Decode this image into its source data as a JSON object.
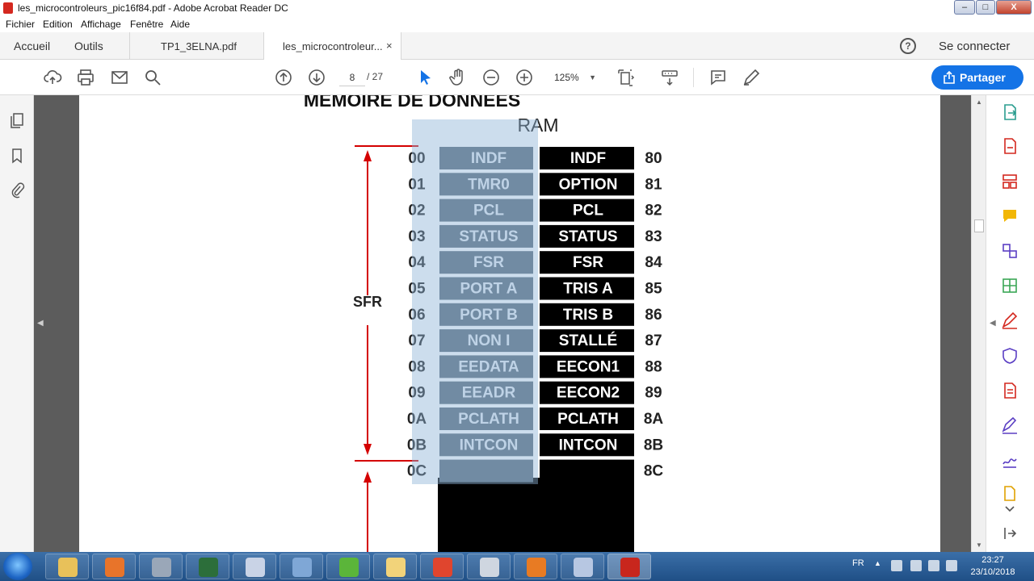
{
  "window": {
    "title": "les_microcontroleurs_pic16f84.pdf - Adobe Acrobat Reader DC",
    "controls": {
      "minimize": "–",
      "maximize": "□",
      "close": "X"
    }
  },
  "menu": [
    "Fichier",
    "Edition",
    "Affichage",
    "Fenêtre",
    "Aide"
  ],
  "tabs": {
    "home": "Accueil",
    "tools": "Outils",
    "doc1": "TP1_3ELNA.pdf",
    "doc2": "les_microcontroleur...",
    "close": "×",
    "help": "?",
    "signin": "Se connecter"
  },
  "toolbar": {
    "page_current": "8",
    "page_total": "/ 27",
    "zoom": "125%",
    "zoom_caret": "▼",
    "share": "Partager"
  },
  "document": {
    "title_line1": "MEMOIRE DE DONNEES",
    "title_line2": "RAM",
    "sfr_label": "SFR",
    "rows": [
      {
        "left_addr": "00",
        "bank0": "INDF",
        "bank1": "INDF",
        "right_addr": "80"
      },
      {
        "left_addr": "01",
        "bank0": "TMR0",
        "bank1": "OPTION",
        "right_addr": "81"
      },
      {
        "left_addr": "02",
        "bank0": "PCL",
        "bank1": "PCL",
        "right_addr": "82"
      },
      {
        "left_addr": "03",
        "bank0": "STATUS",
        "bank1": "STATUS",
        "right_addr": "83"
      },
      {
        "left_addr": "04",
        "bank0": "FSR",
        "bank1": "FSR",
        "right_addr": "84"
      },
      {
        "left_addr": "05",
        "bank0": "PORT A",
        "bank1": "TRIS A",
        "right_addr": "85"
      },
      {
        "left_addr": "06",
        "bank0": "PORT  B",
        "bank1": "TRIS B",
        "right_addr": "86"
      },
      {
        "left_addr": "07",
        "bank0": "NON I",
        "bank1": "STALLÉ",
        "right_addr": "87"
      },
      {
        "left_addr": "08",
        "bank0": "EEDATA",
        "bank1": "EECON1",
        "right_addr": "88"
      },
      {
        "left_addr": "09",
        "bank0": "EEADR",
        "bank1": "EECON2",
        "right_addr": "89"
      },
      {
        "left_addr": "0A",
        "bank0": "PCLATH",
        "bank1": "PCLATH",
        "right_addr": "8A"
      },
      {
        "left_addr": "0B",
        "bank0": "INTCON",
        "bank1": "INTCON",
        "right_addr": "8B"
      },
      {
        "left_addr": "0C",
        "bank0": "",
        "bank1": "",
        "right_addr": "8C"
      }
    ]
  },
  "taskbar": {
    "lang": "FR",
    "time": "23:27",
    "date": "23/10/2018",
    "apps": [
      {
        "name": "explorer",
        "color": "#e8c15a"
      },
      {
        "name": "media-player",
        "color": "#e8742a"
      },
      {
        "name": "app-3d",
        "color": "#9aa7b8"
      },
      {
        "name": "terminal",
        "color": "#2c6e3a"
      },
      {
        "name": "paint",
        "color": "#c9d3e6"
      },
      {
        "name": "calculator",
        "color": "#7fa7d6"
      },
      {
        "name": "utorrent",
        "color": "#5bb53a"
      },
      {
        "name": "folder",
        "color": "#f2d37a"
      },
      {
        "name": "chrome",
        "color": "#e0452e"
      },
      {
        "name": "clock-app",
        "color": "#cfd6e0"
      },
      {
        "name": "firefox",
        "color": "#e87b23"
      },
      {
        "name": "keyboard-app",
        "color": "#b7c7e2"
      },
      {
        "name": "acrobat",
        "color": "#c8261d"
      }
    ]
  },
  "colors": {
    "accent": "#1473e6",
    "bank0_cell": "#5a6b78",
    "bank1_cell": "#000000",
    "arrow": "#d40000",
    "selection": "#8fb3d6"
  }
}
